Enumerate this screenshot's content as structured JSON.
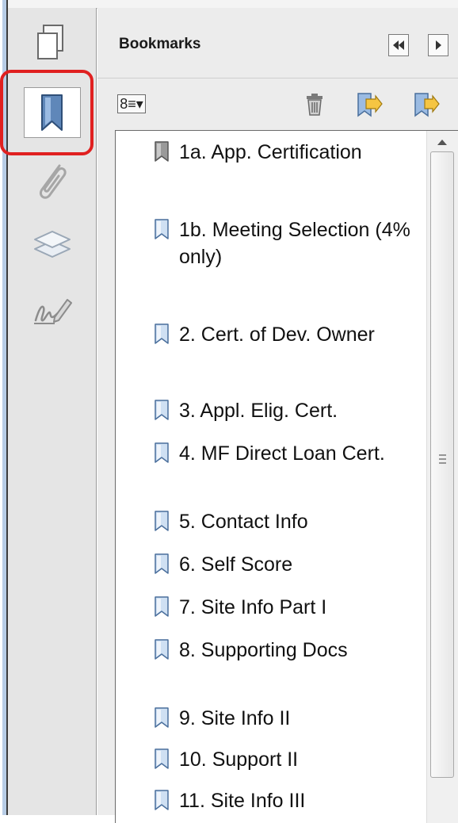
{
  "panel": {
    "title": "Bookmarks"
  },
  "nav": {
    "buttons": [
      {
        "icon": "pages-icon",
        "selected": false
      },
      {
        "icon": "bookmark-icon",
        "selected": true
      },
      {
        "icon": "paperclip-icon",
        "selected": false
      },
      {
        "icon": "layers-icon",
        "selected": false
      },
      {
        "icon": "signature-icon",
        "selected": false
      }
    ]
  },
  "header": {
    "buttons": [
      {
        "icon": "collapse-left-icon"
      },
      {
        "icon": "expand-right-icon"
      }
    ]
  },
  "toolbar": {
    "options": {
      "icon": "options-menu-icon",
      "glyph": "8≡▾"
    },
    "delete": {
      "icon": "trash-icon"
    },
    "new": {
      "icon": "new-bookmark-icon"
    },
    "expand": {
      "icon": "expand-bookmark-icon"
    }
  },
  "bookmarks": [
    {
      "label": "1a. App. Certification",
      "icon": "bookmark-gray-icon"
    },
    {
      "label": "1b. Meeting Selection (4% only)",
      "icon": "bookmark-blue-icon"
    },
    {
      "label": "2. Cert. of Dev. Owner",
      "icon": "bookmark-blue-icon"
    },
    {
      "label": "3. Appl. Elig. Cert.",
      "icon": "bookmark-blue-icon"
    },
    {
      "label": "4. MF Direct Loan Cert.",
      "icon": "bookmark-blue-icon"
    },
    {
      "label": "5. Contact Info",
      "icon": "bookmark-blue-icon"
    },
    {
      "label": "6. Self Score",
      "icon": "bookmark-blue-icon"
    },
    {
      "label": "7. Site Info Part I",
      "icon": "bookmark-blue-icon"
    },
    {
      "label": "8. Supporting Docs",
      "icon": "bookmark-blue-icon"
    },
    {
      "label": "9. Site Info II",
      "icon": "bookmark-blue-icon"
    },
    {
      "label": "10. Support II",
      "icon": "bookmark-blue-icon"
    },
    {
      "label": "11. Site Info III",
      "icon": "bookmark-blue-icon"
    }
  ],
  "colors": {
    "highlight": "#e02020",
    "bookmark_blue": "#cfe0f3",
    "bookmark_gray": "#9a9a9a"
  }
}
